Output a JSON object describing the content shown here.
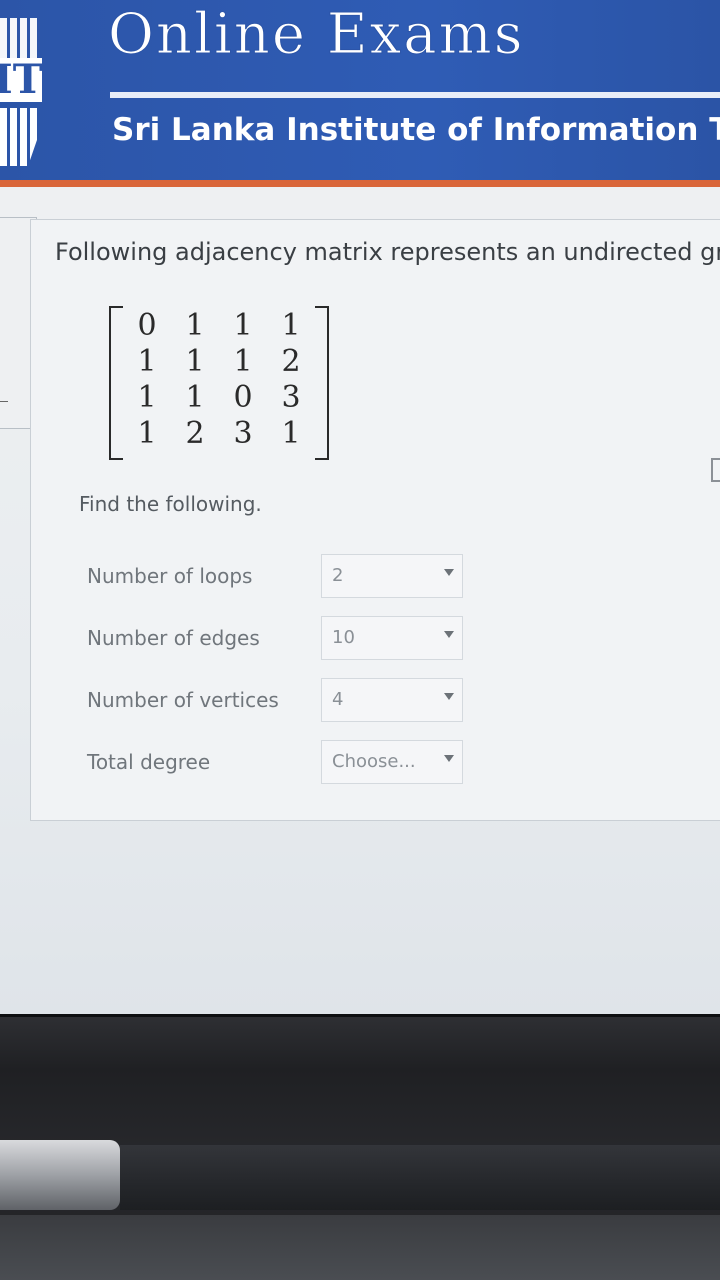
{
  "header": {
    "site_title": "Online Exams",
    "logo_text": "IT",
    "institute": "Sri Lanka Institute of Information Tech"
  },
  "question": {
    "text": "Following adjacency matrix represents an undirected gra",
    "matrix": [
      [
        "0",
        "1",
        "1",
        "1"
      ],
      [
        "1",
        "1",
        "1",
        "2"
      ],
      [
        "1",
        "1",
        "0",
        "3"
      ],
      [
        "1",
        "2",
        "3",
        "1"
      ]
    ],
    "instruction": "Find the following."
  },
  "fields": [
    {
      "label": "Number of loops",
      "value": "2"
    },
    {
      "label": "Number of edges",
      "value": "10"
    },
    {
      "label": "Number of vertices",
      "value": "4"
    },
    {
      "label": "Total degree",
      "value": "Choose..."
    }
  ],
  "colors": {
    "header_blue": "#2c55a8",
    "accent_orange": "#d9663a"
  }
}
